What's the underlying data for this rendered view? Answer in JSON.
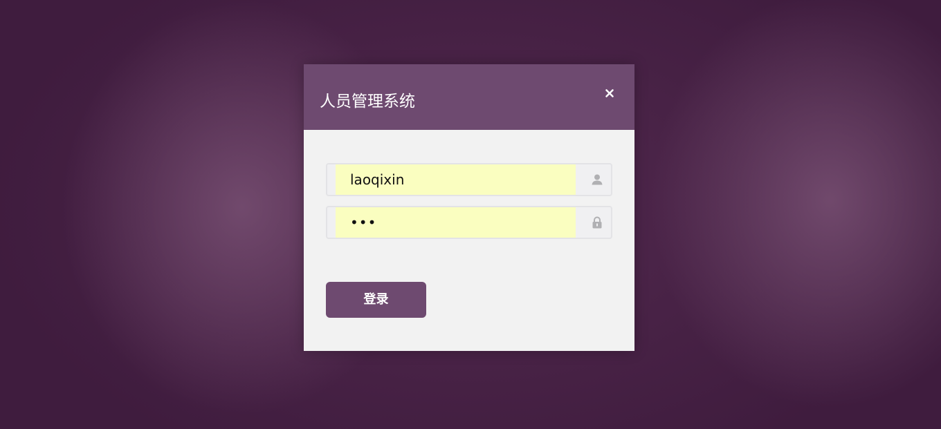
{
  "dialog": {
    "title": "人员管理系统",
    "close_icon": "close-icon"
  },
  "form": {
    "username": {
      "value": "laoqixin",
      "icon": "user-icon",
      "autofill_color": "#fafec0"
    },
    "password": {
      "value": "•••",
      "icon": "lock-icon"
    },
    "login_label": "登录"
  },
  "colors": {
    "accent": "#6e4a70",
    "panel_background": "#f2f2f2",
    "page_background": "#3f1c3e"
  }
}
